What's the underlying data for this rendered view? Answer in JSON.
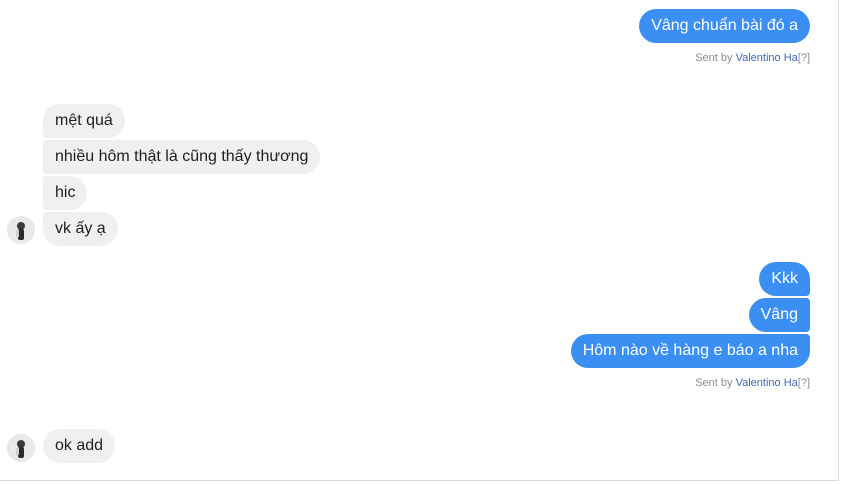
{
  "messages_out_1": [
    {
      "text": "Vâng chuẩn bài đó a"
    }
  ],
  "sent_by_1": {
    "prefix": "Sent by",
    "name": "Valentino Ha",
    "help": "[?]"
  },
  "messages_in_1": [
    {
      "text": "mệt quá"
    },
    {
      "text": "nhiều hôm thật là cũng thấy thương"
    },
    {
      "text": "hic"
    },
    {
      "text": "vk ấy ạ"
    }
  ],
  "messages_out_2": [
    {
      "text": "Kkk"
    },
    {
      "text": "Vâng"
    },
    {
      "text": "Hôm nào về hàng e báo a nha"
    }
  ],
  "sent_by_2": {
    "prefix": "Sent by",
    "name": "Valentino Ha",
    "help": "[?]"
  },
  "messages_in_2": [
    {
      "text": "ok add"
    }
  ],
  "colors": {
    "outgoing_bubble": "#3b8ff3",
    "incoming_bubble": "#f0f0f0",
    "sender_name": "#4267b2"
  },
  "icons": {
    "avatar": "contact-avatar-icon"
  }
}
